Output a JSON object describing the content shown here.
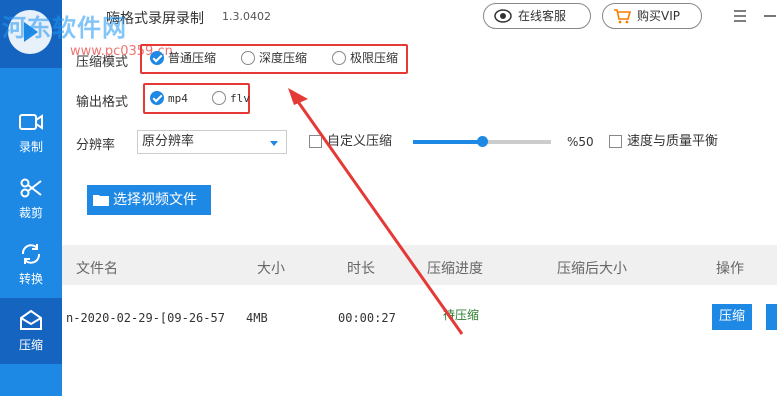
{
  "app": {
    "title": "嗨格式录屏录制",
    "version": "1.3.0402",
    "watermark": "河东软件网",
    "watermark_url": "www.pc0359.cn"
  },
  "header": {
    "service_label": "在线客服",
    "vip_label": "购买VIP",
    "menu_icon": "menu-icon",
    "minimize_icon": "minimize-icon"
  },
  "sidebar": {
    "items": [
      {
        "label": "录制",
        "icon": "video-camera-icon"
      },
      {
        "label": "裁剪",
        "icon": "scissors-icon"
      },
      {
        "label": "转换",
        "icon": "refresh-icon"
      },
      {
        "label": "压缩",
        "icon": "envelope-icon"
      }
    ],
    "active": "压缩"
  },
  "settings": {
    "mode_label": "压缩模式",
    "modes": [
      {
        "label": "普通压缩",
        "checked": true
      },
      {
        "label": "深度压缩",
        "checked": false
      },
      {
        "label": "极限压缩",
        "checked": false
      }
    ],
    "format_label": "输出格式",
    "formats": [
      {
        "label": "mp4",
        "checked": true
      },
      {
        "label": "flv",
        "checked": false
      }
    ],
    "resolution_label": "分辨率",
    "resolution_value": "原分辨率",
    "custom_label": "自定义压缩",
    "custom_checked": false,
    "quality_percent": 50,
    "quality_text": "%50",
    "balance_label": "速度与质量平衡",
    "balance_checked": false,
    "choose_button": "选择视频文件"
  },
  "table": {
    "headers": [
      "文件名",
      "大小",
      "时长",
      "压缩进度",
      "压缩后大小",
      "操作"
    ],
    "rows": [
      {
        "name": "n-2020-02-29-[09-26-57",
        "size": "4MB",
        "duration": "00:00:27",
        "status": "待压缩",
        "after": "",
        "action": "压缩"
      }
    ]
  },
  "colors": {
    "accent": "#1e88e5",
    "sidebar_active": "#1565c0",
    "highlight": "#e53935",
    "status": "#2e7d32"
  }
}
